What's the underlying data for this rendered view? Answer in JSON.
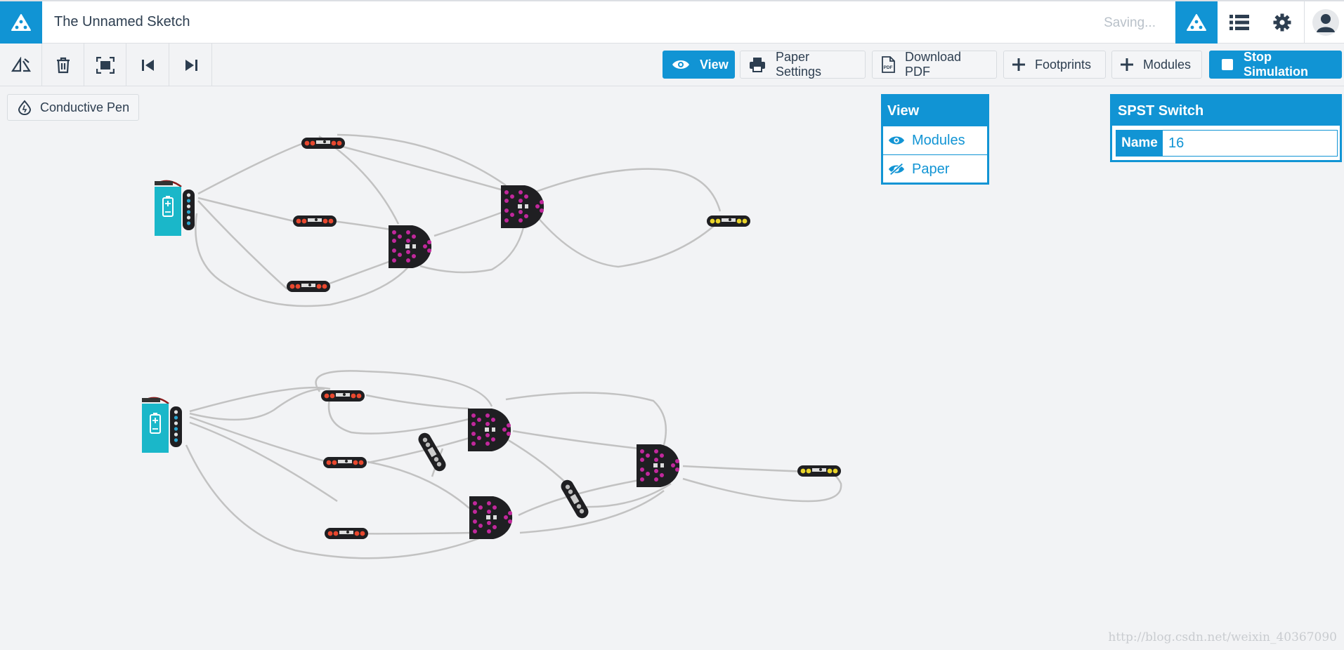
{
  "app": {
    "sketch_title": "The Unnamed Sketch",
    "status": "Saving..."
  },
  "header_icons": [
    "logo-icon",
    "modules-icon",
    "list-icon",
    "gear-icon",
    "user-icon"
  ],
  "toolbar": {
    "view_label": "View",
    "paper_settings_label": "Paper Settings",
    "download_pdf_label": "Download PDF",
    "footprints_label": "Footprints",
    "modules_label": "Modules",
    "stop_simulation_label": "Stop Simulation"
  },
  "tool": {
    "conductive_pen_label": "Conductive Pen"
  },
  "view_panel": {
    "title": "View",
    "items": [
      {
        "label": "Modules",
        "icon": "eye-icon"
      },
      {
        "label": "Paper",
        "icon": "eye-slash-icon"
      }
    ]
  },
  "properties_panel": {
    "title": "SPST Switch",
    "name_label": "Name",
    "name_value": "16"
  },
  "colors": {
    "accent": "#1194d4",
    "wire": "#c2c2c2",
    "module_body": "#1f1f22",
    "battery": "#1ab7c9",
    "led_red": "#e8482f",
    "led_yellow": "#e8d32a",
    "pad_magenta": "#c1289c"
  },
  "watermark": "http://blog.csdn.net/weixin_40367090"
}
